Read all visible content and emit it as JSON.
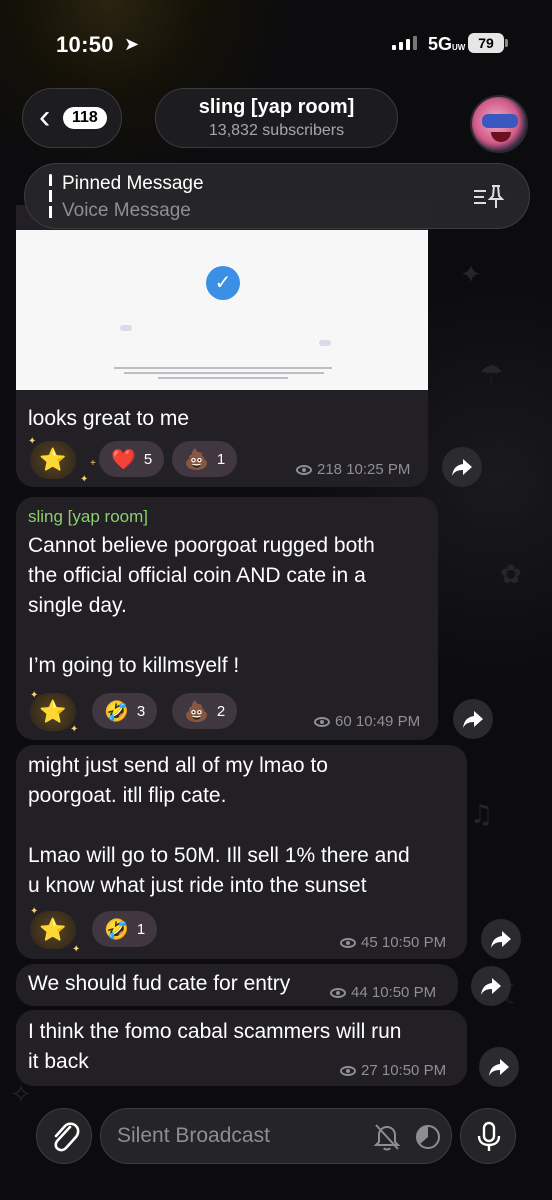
{
  "status_bar": {
    "time": "10:50",
    "network": "5G",
    "network_suffix": "UW",
    "battery": "79"
  },
  "header": {
    "back_count": "118",
    "title": "sling [yap room]",
    "subtitle": "13,832 subscribers",
    "avatar_icon": "channel-avatar"
  },
  "pinned": {
    "title": "Pinned Message",
    "subtitle": "Voice Message"
  },
  "messages": [
    {
      "text": "looks great to me",
      "reactions": [
        {
          "emoji": "⭐",
          "count": ""
        },
        {
          "emoji": "❤️",
          "count": "5"
        },
        {
          "emoji": "💩",
          "count": "1"
        }
      ],
      "views": "218",
      "time": "10:25 PM"
    },
    {
      "sender": "sling [yap room]",
      "text": "Cannot believe poorgoat rugged both\nthe official official coin AND cate in a\nsingle day.\n\nI’m going to killmsyelf !",
      "reactions": [
        {
          "emoji": "⭐",
          "count": ""
        },
        {
          "emoji": "🤣",
          "count": "3"
        },
        {
          "emoji": "💩",
          "count": "2"
        }
      ],
      "views": "60",
      "time": "10:49 PM"
    },
    {
      "text": "might just send all of my lmao to\npoorgoat. itll flip cate.\n\nLmao will go to 50M. Ill sell 1% there and\nu know what just ride into the sunset",
      "reactions": [
        {
          "emoji": "⭐",
          "count": ""
        },
        {
          "emoji": "🤣",
          "count": "1"
        }
      ],
      "views": "45",
      "time": "10:50 PM"
    },
    {
      "text": "We should fud cate for entry",
      "views": "44",
      "time": "10:50 PM"
    },
    {
      "text": "I think the fomo cabal scammers will run\nit back",
      "views": "27",
      "time": "10:50 PM"
    }
  ],
  "composer": {
    "placeholder": "Silent Broadcast"
  },
  "colors": {
    "sender_name": "#8ccf6b",
    "verified_badge": "#3b8fe4",
    "bubble_bg": "#231f27"
  }
}
